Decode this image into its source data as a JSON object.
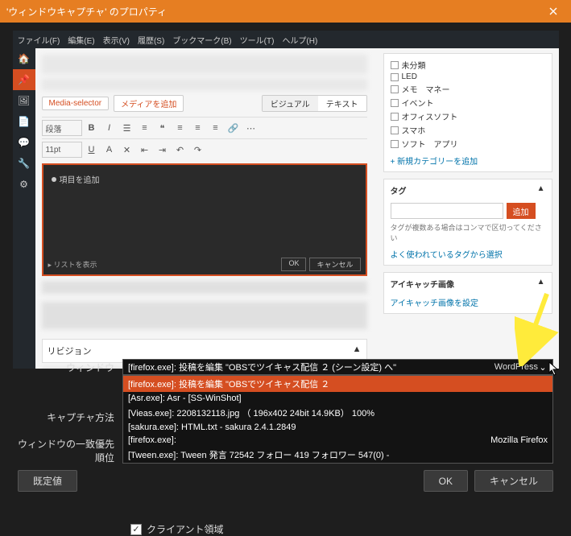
{
  "titlebar": {
    "title": "'ウィンドウキャプチャ' のプロパティ"
  },
  "wp_menubar": [
    "ファイル(F)",
    "編集(E)",
    "表示(V)",
    "履歴(S)",
    "ブックマーク(B)",
    "ツール(T)",
    "ヘルプ(H)"
  ],
  "media": {
    "selector": "Media-selector",
    "add": "メディアを追加"
  },
  "view_tabs": {
    "visual": "ビジュアル",
    "text": "テキスト"
  },
  "toolbar": {
    "para": "段落",
    "size_label": "11pt"
  },
  "editor": {
    "add_item": "項目を追加",
    "list_label": "リストを表示",
    "btn_ok": "OK",
    "btn_cancel": "キャンセル"
  },
  "revision": {
    "title": "リビジョン",
    "caret": "▲"
  },
  "side_cat": {
    "items": [
      "未分類",
      "LED",
      "メモ　マネー",
      "イベント",
      "オフィスソフト",
      "スマホ",
      "ソフト　アプリ"
    ],
    "add_link": "+ 新規カテゴリーを追加"
  },
  "side_tag": {
    "title": "タグ",
    "caret": "▲",
    "add_btn": "追加",
    "note": "タグが複数ある場合はコンマで区切ってください",
    "link": "よく使われているタグから選択"
  },
  "side_eye": {
    "title": "アイキャッチ画像",
    "caret": "▲",
    "link": "アイキャッチ画像を設定"
  },
  "controls": {
    "window_label": "ウィンドウ",
    "capture_label": "キャプチャ方法",
    "priority_label": "ウィンドウの一致優先順位"
  },
  "selected": {
    "text": "[firefox.exe]: 投稿を編集 \"OBSでツイキャス配信 ２ (シーン設定) へ\"",
    "right": "WordPress"
  },
  "options": [
    {
      "text": "[firefox.exe]: 投稿を編集 \"OBSでツイキャス配信 ２",
      "highlight": true
    },
    {
      "text": "[Asr.exe]: Asr - [SS-WinShot]"
    },
    {
      "text": "[Vieas.exe]: 2208132118.jpg （ 196x402  24bit  14.9KB）  100%"
    },
    {
      "text": "[sakura.exe]: HTML.txt - sakura 2.4.1.2849"
    },
    {
      "text": "[firefox.exe]:",
      "right": "Mozilla Firefox",
      "blur": true
    },
    {
      "text": "[Tween.exe]: Tween  発言 72542  フォロー 419  フォロワー 547(0) -",
      "blur_tail": true
    }
  ],
  "client_area": {
    "label": "クライアント領域",
    "checked": true
  },
  "footer": {
    "default": "既定値",
    "ok": "OK",
    "cancel": "キャンセル"
  }
}
